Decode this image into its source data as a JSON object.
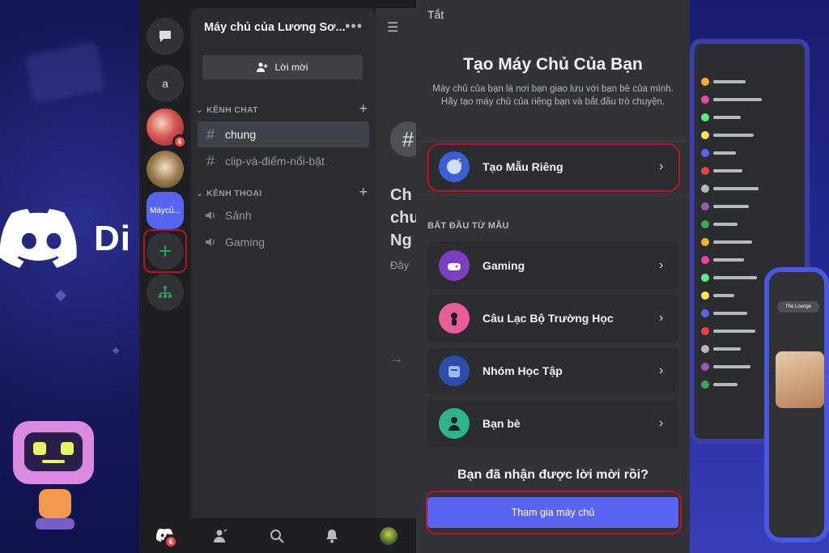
{
  "rail": {
    "server_a_label": "a",
    "active_server_label": "Máycủ...",
    "badge_count": "6"
  },
  "server": {
    "title": "Máy chủ của Lương Sơ...",
    "invite_label": "Lời mời"
  },
  "categories": {
    "chat": "KÊNH CHAT",
    "voice": "KÊNH THOẠI"
  },
  "text_channels": [
    "chung",
    "clip-và-điểm-nổi-bật"
  ],
  "voice_channels": [
    "Sảnh",
    "Gaming"
  ],
  "chat_peek": {
    "line1": "Ch",
    "line2": "chu",
    "line3": "Ng",
    "line4": "Đây"
  },
  "bottom_nav": {
    "badge_count": "6"
  },
  "sheet": {
    "close_label": "Tắt",
    "title": "Tạo Máy Chủ Của Bạn",
    "subtitle": "Máy chủ của bạn là nơi bạn giao lưu với bạn bè của mình. Hãy tạo máy chủ của riêng bạn và bắt đầu trò chuyện.",
    "custom_template": "Tạo Mẫu Riêng",
    "from_template_label": "BẮT ĐẦU TỪ MẪU",
    "templates": [
      "Gaming",
      "Câu Lạc Bộ Trường Học",
      "Nhóm Học Tập",
      "Bạn bè"
    ],
    "have_invite": "Bạn đã nhận được lời mời rồi?",
    "join_button": "Tham gia máy chủ"
  },
  "promo": {
    "brand_word": "Di",
    "phone_header": "The Lounge"
  },
  "colors": {
    "blurple": "#5865f2",
    "highlight_ring": "#c0111e",
    "badge_red": "#f23f43",
    "add_server_green": "#23a55a"
  }
}
